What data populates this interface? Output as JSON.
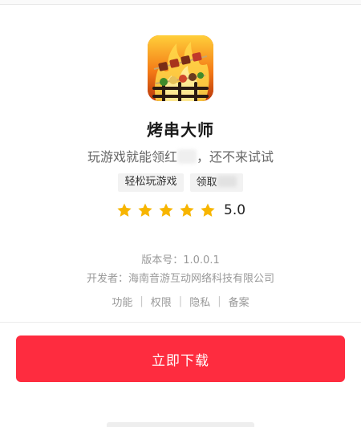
{
  "app": {
    "name": "烤串大师",
    "slogan_before": "玩游戏就能领红",
    "slogan_after": "，还不来试试",
    "tags": [
      {
        "text": "轻松玩游戏"
      },
      {
        "text": "领取"
      }
    ],
    "rating": {
      "stars": 5,
      "max": 5,
      "value": "5.0"
    }
  },
  "meta": {
    "version": "版本号：1.0.0.1",
    "developer": "开发者：海南音游互动网络科技有限公司"
  },
  "links": [
    {
      "label": "功能"
    },
    {
      "label": "权限"
    },
    {
      "label": "隐私"
    },
    {
      "label": "备案"
    }
  ],
  "download": {
    "label": "立即下载"
  },
  "colors": {
    "accent": "#fe2c3f",
    "star": "#f7b500",
    "muted_text": "#999999"
  },
  "icons": {
    "app": "grilled-skewer-app-icon",
    "star": "star-icon"
  }
}
